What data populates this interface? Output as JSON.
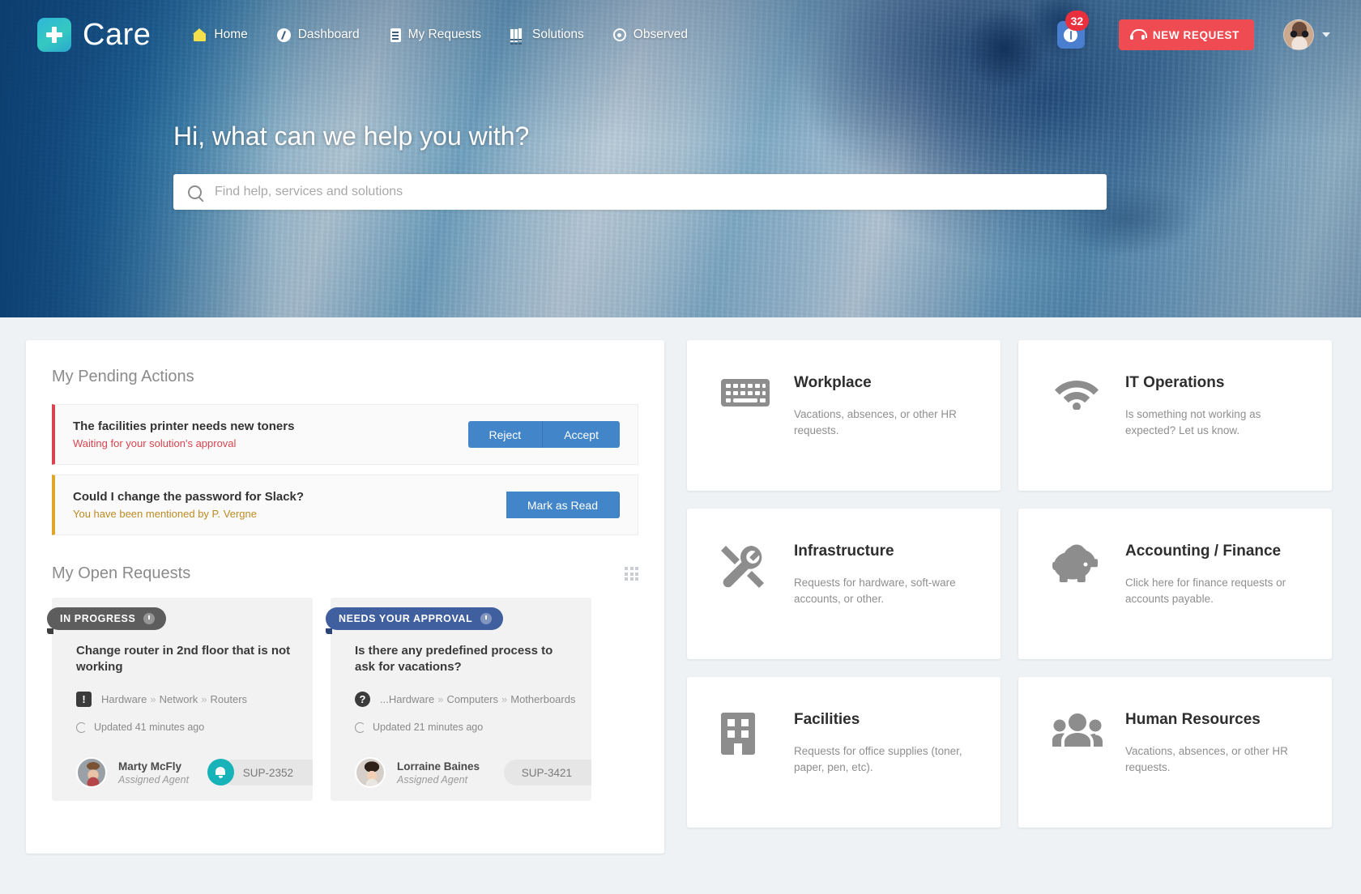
{
  "brand": {
    "name": "Care",
    "logo_icon": "medical-cross-icon"
  },
  "nav": {
    "items": [
      {
        "label": "Home",
        "icon": "home-icon"
      },
      {
        "label": "Dashboard",
        "icon": "dashboard-icon"
      },
      {
        "label": "My Requests",
        "icon": "document-icon"
      },
      {
        "label": "Solutions",
        "icon": "books-icon"
      },
      {
        "label": "Observed",
        "icon": "eye-icon"
      }
    ],
    "notifications": {
      "count": "32",
      "icon": "exclamation-icon"
    },
    "new_request_label": "NEW REQUEST",
    "new_request_icon": "headset-icon",
    "avatar_icon": "user-avatar",
    "avatar_caret_icon": "chevron-down-icon"
  },
  "hero": {
    "title": "Hi, what can we help you with?",
    "search_placeholder": "Find help, services and solutions",
    "search_value": "",
    "search_icon": "search-icon"
  },
  "pending": {
    "heading": "My Pending Actions",
    "items": [
      {
        "title": "The facilities printer needs new toners",
        "subtitle": "Waiting for your solution's approval",
        "accent": "#d9444f",
        "buttons": [
          "Reject",
          "Accept"
        ]
      },
      {
        "title": "Could I change the password for Slack?",
        "subtitle": "You have been mentioned by P. Vergne",
        "accent": "#e0a62b",
        "buttons": [
          "Mark as Read"
        ]
      }
    ]
  },
  "open_requests": {
    "heading": "My Open Requests",
    "view_toggle_icon": "grid-view-icon",
    "cards": [
      {
        "status": "IN PROGRESS",
        "status_color": "#5d5d5d",
        "status_icon": "clock-icon",
        "title": "Change router in 2nd floor that is not working",
        "category_icon": "alert-icon",
        "path": [
          "Hardware",
          "Network",
          "Routers"
        ],
        "updated": "Updated 41 minutes ago",
        "updated_icon": "refresh-icon",
        "agent_name": "Marty McFly",
        "agent_role": "Assigned Agent",
        "ticket": "SUP-2352",
        "has_bell": true,
        "bell_icon": "bell-icon"
      },
      {
        "status": "NEEDS YOUR APPROVAL",
        "status_color": "#3f5f9e",
        "status_icon": "clock-icon",
        "title": "Is there any predefined process to ask for vacations?",
        "category_icon": "question-icon",
        "path": [
          "...Hardware",
          "Computers",
          "Motherboards"
        ],
        "updated": "Updated 21 minutes ago",
        "updated_icon": "refresh-icon",
        "agent_name": "Lorraine Baines",
        "agent_role": "Assigned Agent",
        "ticket": "SUP-3421",
        "has_bell": false,
        "bell_icon": ""
      }
    ]
  },
  "categories": [
    {
      "title": "Workplace",
      "desc": "Vacations, absences, or other HR requests.",
      "icon": "keyboard-icon"
    },
    {
      "title": "IT Operations",
      "desc": "Is something not working as expected? Let us know.",
      "icon": "wifi-icon"
    },
    {
      "title": "Infrastructure",
      "desc": "Requests for hardware, soft-ware accounts, or other.",
      "icon": "tools-icon"
    },
    {
      "title": "Accounting / Finance",
      "desc": "Click here for finance requests or accounts payable.",
      "icon": "piggy-bank-icon"
    },
    {
      "title": "Facilities",
      "desc": "Requests for office supplies (toner, paper, pen, etc).",
      "icon": "building-icon"
    },
    {
      "title": "Human Resources",
      "desc": "Vacations, absences, or other HR requests.",
      "icon": "people-icon"
    }
  ],
  "colors": {
    "accent_red": "#ee4b52",
    "accent_blue": "#4285c9",
    "brand_teal": "#34c9c0",
    "badge_red": "#e8303f",
    "bell_teal": "#17b3b8"
  }
}
